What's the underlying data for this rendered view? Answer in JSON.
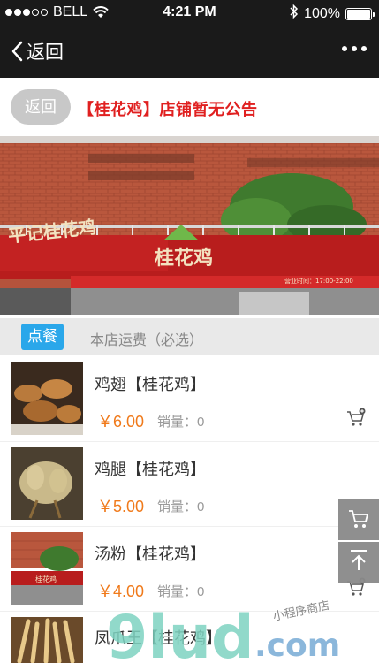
{
  "status_bar": {
    "carrier": "BELL",
    "time": "4:21 PM",
    "battery": "100%",
    "signal_strength_filled": 3,
    "signal_strength_total": 5
  },
  "nav": {
    "back_label": "返回"
  },
  "notice": {
    "back_button": "返回",
    "text": "【桂花鸡】店铺暂无公告"
  },
  "banner": {
    "sign_left": "平记桂花鸡",
    "sign_main": "桂花鸡",
    "sign_hours": "营业时间：17:00-22:00"
  },
  "tabs": {
    "active": "点餐",
    "fee": "本店运费（必选）"
  },
  "products": [
    {
      "name": "鸡翅【桂花鸡】",
      "price": "￥6.00",
      "sales": "销量：0"
    },
    {
      "name": "鸡腿【桂花鸡】",
      "price": "￥5.00",
      "sales": "销量：0"
    },
    {
      "name": "汤粉【桂花鸡】",
      "price": "￥4.00",
      "sales": "销量：0"
    },
    {
      "name": "凤爪王【桂花鸡】",
      "price": "",
      "sales": ""
    }
  ],
  "watermark": {
    "brand": "9lud",
    "domain": ".com",
    "tagline": "小程序商店"
  },
  "colors": {
    "accent": "#2aa7ea",
    "price": "#f07a1b",
    "notice": "#e02020",
    "nav_bg": "#1a1a1a"
  },
  "icons": [
    "back-chevron-icon",
    "more-dots-icon",
    "bluetooth-icon",
    "wifi-icon",
    "cart-add-icon",
    "cart-icon",
    "back-to-top-icon"
  ]
}
